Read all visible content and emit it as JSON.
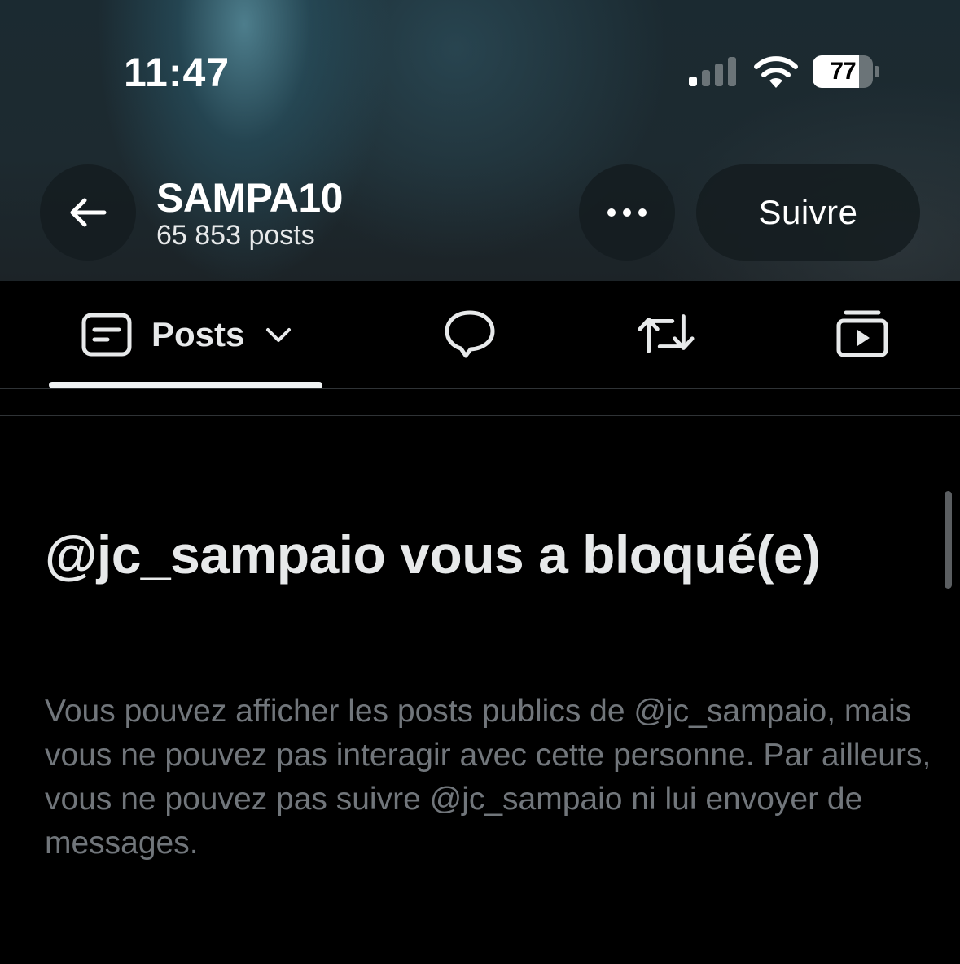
{
  "status_bar": {
    "time": "11:47",
    "signal_bars_active": 1,
    "signal_bars_total": 4,
    "battery_level": "77",
    "battery_fraction": 0.77
  },
  "header": {
    "back_icon": "arrow-left-icon",
    "profile_name": "SAMPA10",
    "post_count": "65 853 posts",
    "more_icon": "ellipsis-icon",
    "follow_label": "Suivre"
  },
  "tabs": {
    "active": {
      "icon": "posts-icon",
      "label": "Posts",
      "dropdown_icon": "chevron-down-icon"
    },
    "others": [
      {
        "icon": "reply-bubble-icon"
      },
      {
        "icon": "repost-icon"
      },
      {
        "icon": "media-icon"
      }
    ]
  },
  "blocked_notice": {
    "title": "@jc_sampaio vous a bloqué(e)",
    "description": "Vous pouvez afficher les posts publics de @jc_sampaio, mais vous ne pouvez pas interagir avec cette personne. Par ailleurs, vous ne pouvez pas suivre @jc_sampaio ni lui envoyer de messages."
  },
  "colors": {
    "background": "#000000",
    "primary_text": "#e7e9ea",
    "secondary_text": "#71767b",
    "divider": "#2f3336"
  }
}
